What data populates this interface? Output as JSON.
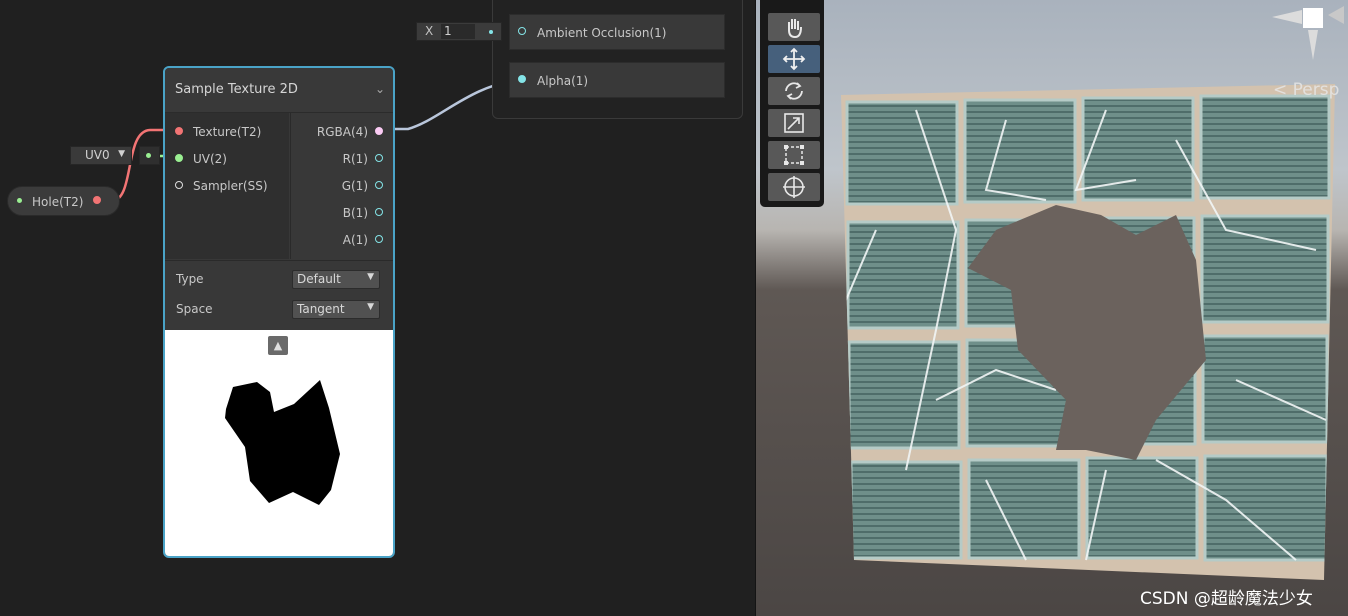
{
  "master_stack": {
    "slots": [
      {
        "label": "Ambient Occlusion(1)"
      },
      {
        "label": "Alpha(1)"
      }
    ],
    "ao_input": {
      "axis": "X",
      "value": "1"
    }
  },
  "sample_texture": {
    "title": "Sample Texture 2D",
    "inputs": [
      "Texture(T2)",
      "UV(2)",
      "Sampler(SS)"
    ],
    "outputs": [
      "RGBA(4)",
      "R(1)",
      "G(1)",
      "B(1)",
      "A(1)"
    ],
    "type_label": "Type",
    "type_value": "Default",
    "space_label": "Space",
    "space_value": "Tangent"
  },
  "uv_node": {
    "value": "UV0"
  },
  "property_node": {
    "label": "Hole(T2)"
  },
  "scene_view": {
    "projection_label": "< Persp",
    "watermark": "CSDN @超龄魔法少女"
  },
  "colors": {
    "graph_background": "#202020",
    "node_selection_outline": "#4aa3c7",
    "texture_port": "#f27474",
    "vector2_port": "#9aef92",
    "float_port": "#84e4e7",
    "vector4_port": "#fbcbf4",
    "sampler_port": "#dedede",
    "active_tool": "#46607c"
  },
  "icons": {
    "collapse": "chevron-down-icon",
    "preview_toggle": "chevron-up-icon",
    "tools": [
      "hand-icon",
      "move-icon",
      "rotate-icon",
      "scale-icon",
      "rect-icon",
      "transform-icon"
    ]
  }
}
